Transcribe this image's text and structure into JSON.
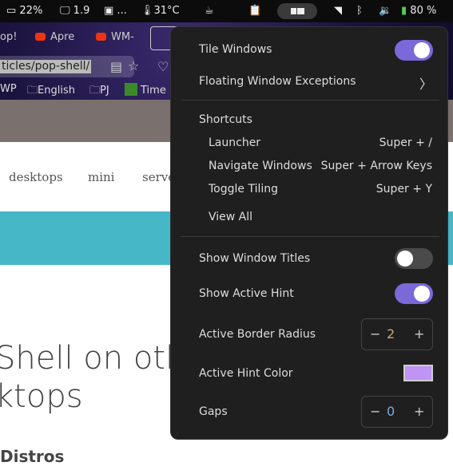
{
  "topbar": {
    "cpu": "22%",
    "monitor": "1.9",
    "memory": "...",
    "temp": "31°C",
    "battery": "80 %"
  },
  "browser": {
    "tabs": [
      "op!",
      "Apre",
      "WM-"
    ],
    "url": "ticles/pop-shell/",
    "bookmarks": [
      "WP",
      "English",
      "PJ",
      "Time"
    ]
  },
  "page": {
    "nav": [
      "desktops",
      "mini",
      "serve"
    ],
    "heading_line1": "Shell on oth",
    "heading_line2": "ktops",
    "subheading": "Distros"
  },
  "menu": {
    "tile_windows": {
      "label": "Tile Windows",
      "on": true
    },
    "floating_exceptions": "Floating Window Exceptions",
    "shortcuts_title": "Shortcuts",
    "shortcuts": [
      {
        "label": "Launcher",
        "keys": "Super + /"
      },
      {
        "label": "Navigate Windows",
        "keys": "Super + Arrow Keys"
      },
      {
        "label": "Toggle Tiling",
        "keys": "Super + Y"
      }
    ],
    "view_all": "View All",
    "show_titles": {
      "label": "Show Window Titles",
      "on": false
    },
    "show_hint": {
      "label": "Show Active Hint",
      "on": true
    },
    "border_radius": {
      "label": "Active Border Radius",
      "value": "2"
    },
    "hint_color": {
      "label": "Active Hint Color",
      "color": "#bf94f5"
    },
    "gaps": {
      "label": "Gaps",
      "value": "0"
    },
    "accent": "#7b68d9"
  }
}
